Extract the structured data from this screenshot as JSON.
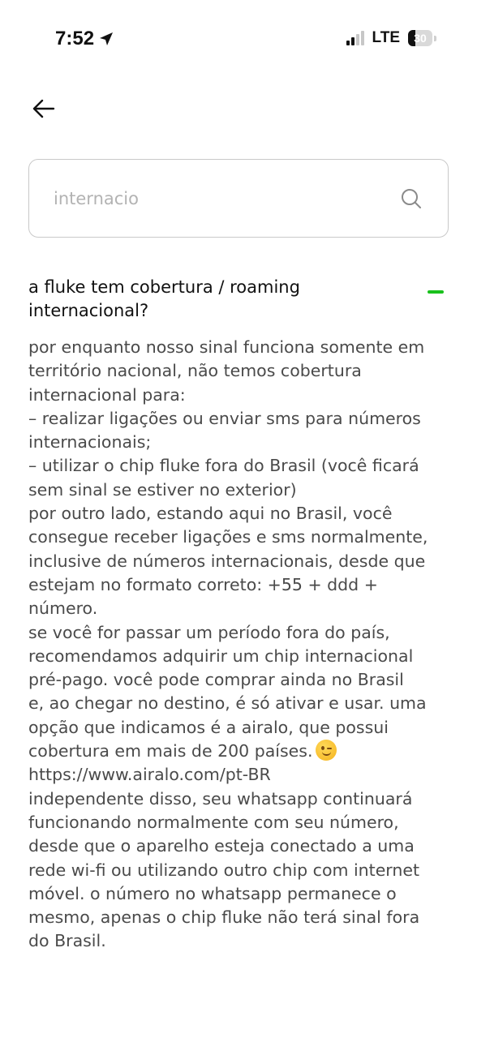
{
  "status_bar": {
    "time": "7:52",
    "network": "LTE",
    "battery_level": "30",
    "battery_fraction": 0.3
  },
  "search": {
    "value": "internacio",
    "icons": {
      "search": "search-icon"
    }
  },
  "navigation": {
    "back_icon": "arrow-left-icon"
  },
  "faq": {
    "question": "a fluke tem cobertura / roaming internacional?",
    "accent_color": "#19c11c",
    "answer_lines": [
      "por enquanto nosso sinal funciona somente em",
      "território nacional, não temos cobertura",
      "internacional para:",
      "– realizar ligações ou enviar sms para números",
      "internacionais;",
      "– utilizar o chip fluke fora do Brasil (você ficará",
      "sem sinal se estiver no exterior)",
      "por outro lado, estando aqui no Brasil, você",
      "consegue receber ligações e sms normalmente,",
      "inclusive de números internacionais, desde que",
      "estejam no formato correto: +55 + ddd +",
      "número.",
      "se você for passar um período fora do país,",
      "recomendamos adquirir um chip internacional",
      "pré-pago. você pode comprar ainda no Brasil",
      "e, ao chegar no destino, é só ativar e usar. uma",
      "opção que indicamos é a airalo, que possui",
      "cobertura em mais de 200 países.",
      "https://www.airalo.com/pt-BR",
      "independente disso, seu whatsapp continuará",
      "funcionando normalmente com seu número,",
      "desde que o aparelho esteja conectado a uma",
      "rede wi-fi ou utilizando outro chip com internet",
      "móvel. o número no whatsapp permanece o",
      "mesmo, apenas o chip fluke não terá sinal fora",
      "do Brasil."
    ],
    "emoji": "winking-face-emoji"
  }
}
